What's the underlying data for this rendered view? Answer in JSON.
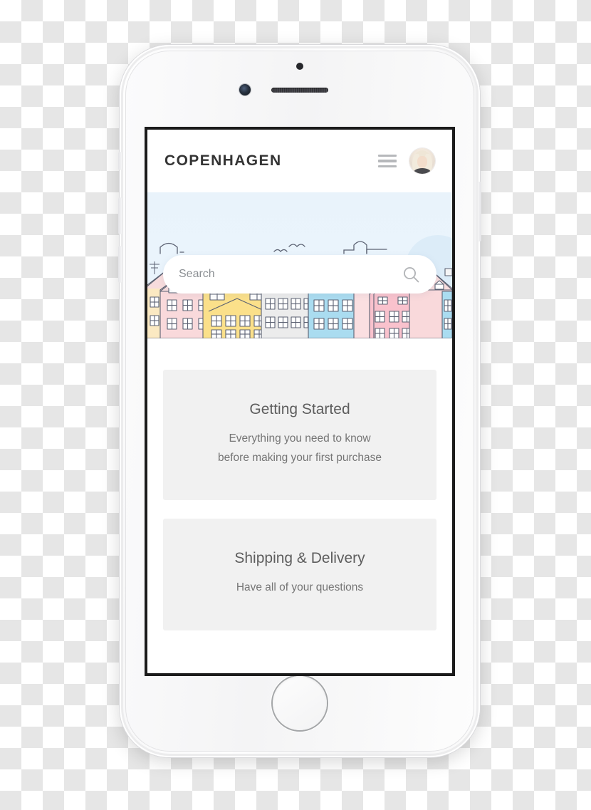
{
  "app": {
    "header": {
      "brand": "COPENHAGEN",
      "menu_icon": "hamburger-menu-icon",
      "avatar_icon": "user-avatar"
    },
    "hero": {
      "search": {
        "placeholder": "Search",
        "value": "",
        "icon": "search-magnifier-icon"
      },
      "illustration": {
        "name": "copenhagen-nyhavn-rowhouses",
        "sky_color": "#eaf4fc",
        "house_colors": [
          "#f9d9db",
          "#fbe9c2",
          "#fbe08a",
          "#ececec",
          "#aadcf0",
          "#f9c2cd",
          "#fadfe1"
        ],
        "roof_color": "#f7dcdd",
        "outline_color": "#5b6172"
      }
    },
    "cards": [
      {
        "title": "Getting Started",
        "line1": "Everything you need to know",
        "line2": "before making your first purchase"
      },
      {
        "title": "Shipping & Delivery",
        "line1": "Have all of your questions",
        "line2": ""
      }
    ]
  },
  "device": {
    "name": "white-iphone-mockup",
    "parts": {
      "home_button": "home-button",
      "front_camera": "front-camera",
      "earpiece": "earpiece-speaker",
      "sensor": "proximity-sensor",
      "mute_switch": "mute-switch",
      "volume_up": "volume-up-button",
      "volume_down": "volume-down-button",
      "power": "power-button"
    }
  },
  "colors": {
    "brand_text": "#343434",
    "card_bg": "#f1f1f1",
    "card_title": "#5e5e5e",
    "card_desc": "#757575",
    "placeholder": "#8b8f93",
    "checker_light": "#ffffff",
    "checker_dark": "#e6e6e6"
  }
}
